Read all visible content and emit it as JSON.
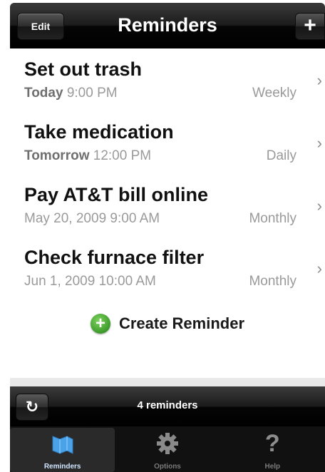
{
  "navbar": {
    "edit_label": "Edit",
    "title": "Reminders",
    "add_label": "+"
  },
  "reminders": [
    {
      "title": "Set out trash",
      "date_bold": "Today",
      "date_rest": " 9:00 PM",
      "frequency": "Weekly"
    },
    {
      "title": "Take medication",
      "date_bold": "Tomorrow",
      "date_rest": " 12:00 PM",
      "frequency": "Daily"
    },
    {
      "title": "Pay AT&T bill online",
      "date_bold": "",
      "date_rest": "May 20, 2009 9:00 AM",
      "frequency": "Monthly"
    },
    {
      "title": "Check furnace filter",
      "date_bold": "",
      "date_rest": "Jun 1, 2009 10:00 AM",
      "frequency": "Monthly"
    }
  ],
  "create": {
    "label": "Create Reminder"
  },
  "toolbar": {
    "count_label": "4 reminders"
  },
  "tabs": [
    {
      "label": "Reminders",
      "icon": "reminders-icon",
      "active": true
    },
    {
      "label": "Options",
      "icon": "gear-icon",
      "active": false
    },
    {
      "label": "Help",
      "icon": "question-icon",
      "active": false
    }
  ],
  "colors": {
    "accent_tab": "#4aa3e8",
    "create_green": "#3c9a2a"
  }
}
